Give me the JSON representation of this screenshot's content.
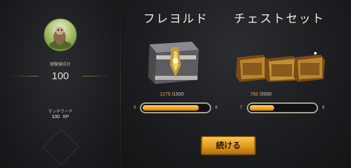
{
  "summary": {
    "label": "経験値合計",
    "total": "100",
    "match_word_label": "マッチワード",
    "xp_value": "100",
    "xp_unit": "XP"
  },
  "rewards": [
    {
      "title": "フレヨルド",
      "current": "1275",
      "max": "/1500",
      "level_from": "5",
      "level_to": "6",
      "progress": 0.85,
      "icon": "freljord-chest-icon"
    },
    {
      "title": "チェストセット",
      "current": "750",
      "max": "/2000",
      "level_from": "7",
      "level_to": "8",
      "progress": 0.375,
      "icon": "chest-set-icon"
    }
  ],
  "continue_label": "続ける"
}
